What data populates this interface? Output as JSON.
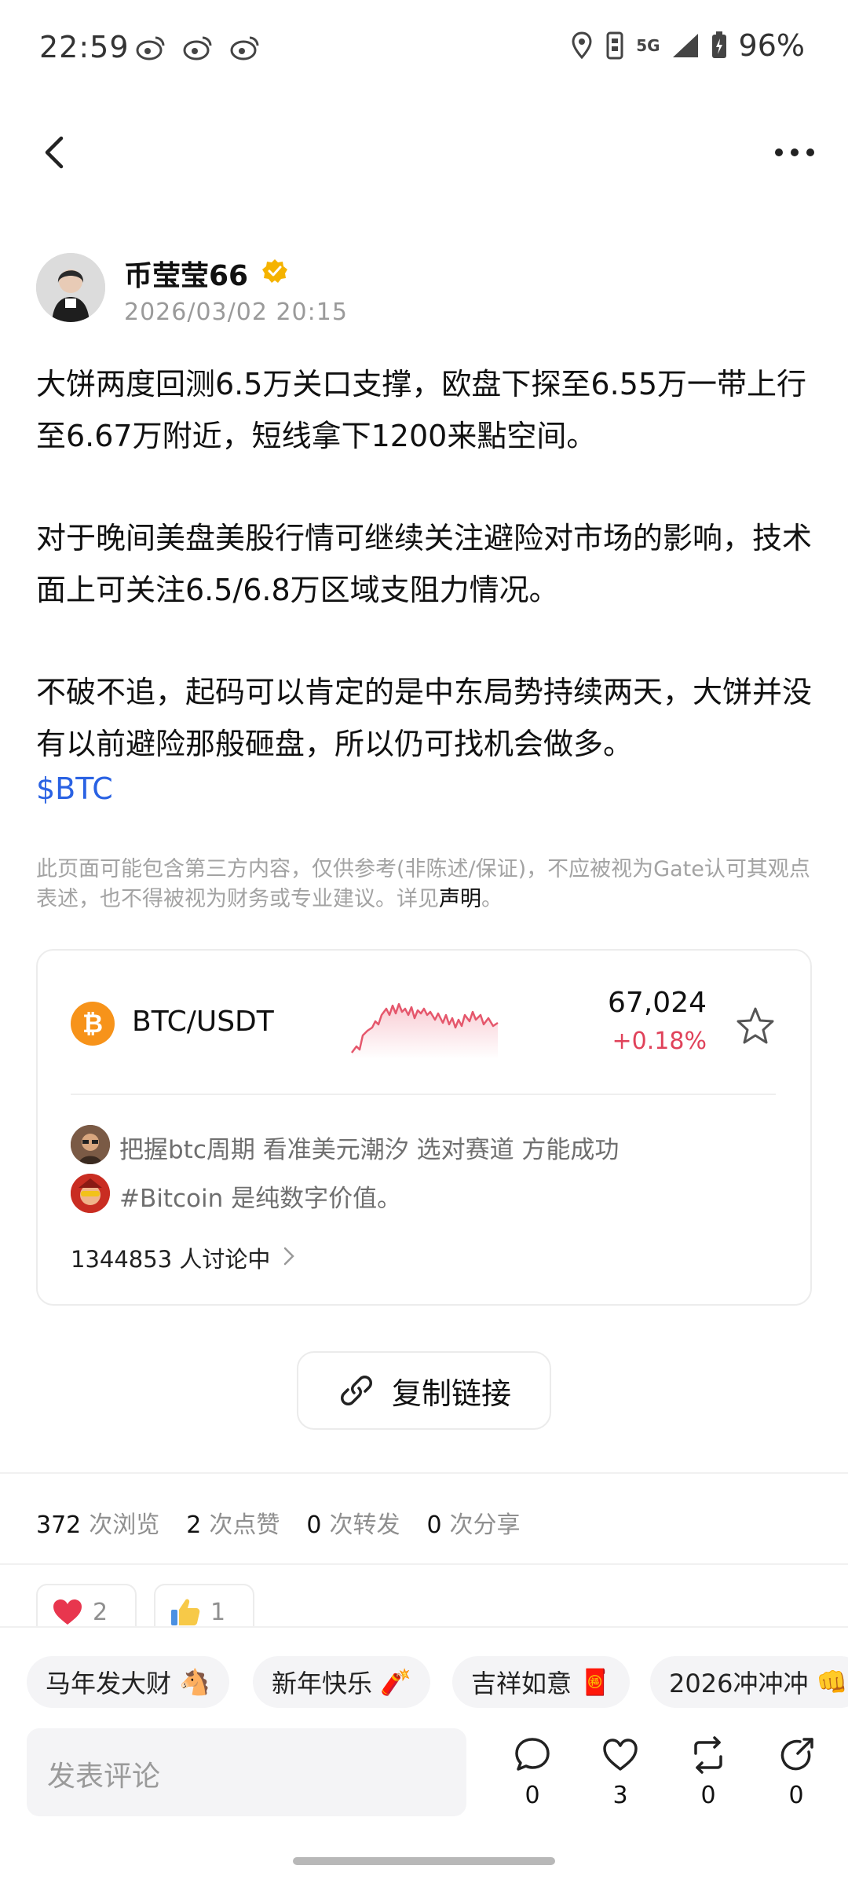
{
  "status_bar": {
    "time": "22:59",
    "battery": "96%",
    "network": "5G"
  },
  "author": {
    "name": "币莹莹66",
    "time": "2026/03/02 20:15"
  },
  "post": {
    "paragraphs": [
      "大饼两度回测6.5万关口支撑，欧盘下探至6.55万一带上行至6.67万附近，短线拿下1200来點空间。",
      "对于晚间美盘美股行情可继续关注避险对市场的影响，技术面上可关注6.5/6.8万区域支阻力情况。",
      "不破不追，起码可以肯定的是中东局势持续两天，大饼并没有以前避险那般砸盘，所以仍可找机会做多。"
    ],
    "tag": "$BTC"
  },
  "disclaimer": {
    "text": "此页面可能包含第三方内容，仅供参考(非陈述/保证)，不应被视为Gate认可其观点表述，也不得被视为财务或专业建议。详见",
    "link": "声明",
    "end": "。"
  },
  "market": {
    "pair": "BTC/USDT",
    "price": "67,024",
    "change": "+0.18%",
    "discussions": [
      "把握btc周期 看准美元潮汐 选对赛道 方能成功",
      "#Bitcoin 是纯数字价值。"
    ],
    "discussing": "1344853 人讨论中"
  },
  "copy_link": "复制链接",
  "stats": {
    "views": "372",
    "views_label": "次浏览",
    "likes": "2",
    "likes_label": "次点赞",
    "reposts": "0",
    "reposts_label": "次转发",
    "shares": "0",
    "shares_label": "次分享"
  },
  "reactions": [
    {
      "icon": "heart",
      "count": "2"
    },
    {
      "icon": "thumbs-up",
      "count": "1"
    }
  ],
  "chips": [
    {
      "label": "马年发大财",
      "emoji": "🐴"
    },
    {
      "label": "新年快乐",
      "emoji": "🧨"
    },
    {
      "label": "吉祥如意",
      "emoji": "🧧"
    },
    {
      "label": "2026冲冲冲",
      "emoji": "👊"
    }
  ],
  "comment": {
    "placeholder": "发表评论"
  },
  "actions": {
    "comments": "0",
    "likes": "3",
    "reposts": "0",
    "shares": "0"
  },
  "colors": {
    "accent_blue": "#2a62e3",
    "up_red": "#e0425a",
    "btc_orange": "#f7931a",
    "verified": "#f5b300"
  }
}
